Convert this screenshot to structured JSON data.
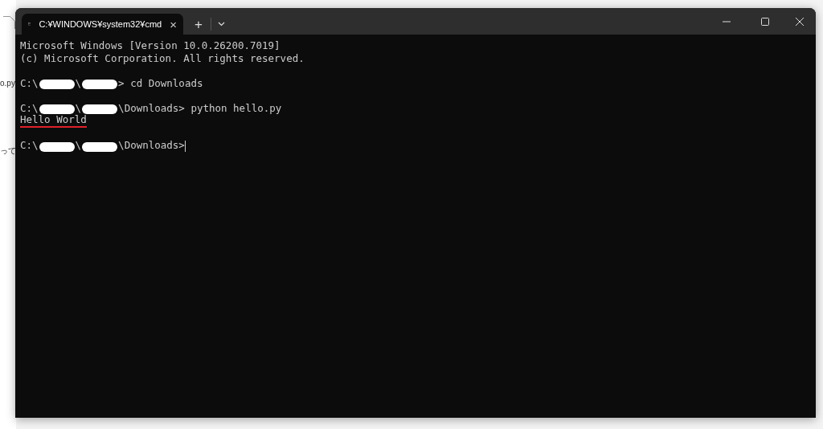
{
  "background": {
    "texts": [
      "o.py",
      "って"
    ]
  },
  "window": {
    "tab": {
      "title": "C:¥WINDOWS¥system32¥cmd",
      "close": "×"
    },
    "new_tab": "+"
  },
  "console": {
    "lines": [
      {
        "space_before": false,
        "segments": [
          {
            "kind": "text",
            "text": "Microsoft Windows [Version 10.0.26200.7019]"
          }
        ]
      },
      {
        "space_before": false,
        "segments": [
          {
            "kind": "text",
            "text": "(c) Microsoft Corporation. All rights reserved."
          }
        ]
      },
      {
        "space_before": true,
        "segments": [
          {
            "kind": "text",
            "text": "C:\\"
          },
          {
            "kind": "redacted"
          },
          {
            "kind": "text",
            "text": "\\"
          },
          {
            "kind": "redacted"
          },
          {
            "kind": "text",
            "text": "> cd Downloads"
          }
        ]
      },
      {
        "space_before": true,
        "segments": [
          {
            "kind": "text",
            "text": "C:\\"
          },
          {
            "kind": "redacted"
          },
          {
            "kind": "text",
            "text": "\\"
          },
          {
            "kind": "redacted"
          },
          {
            "kind": "text",
            "text": "\\Downloads> python hello.py"
          }
        ]
      },
      {
        "space_before": false,
        "segments": [
          {
            "kind": "text",
            "text": "Hello World"
          }
        ],
        "underlined": true
      },
      {
        "space_before": true,
        "segments": [
          {
            "kind": "text",
            "text": "C:\\"
          },
          {
            "kind": "redacted"
          },
          {
            "kind": "text",
            "text": "\\"
          },
          {
            "kind": "redacted"
          },
          {
            "kind": "text",
            "text": "\\Downloads>"
          }
        ],
        "cursor": true
      }
    ]
  }
}
